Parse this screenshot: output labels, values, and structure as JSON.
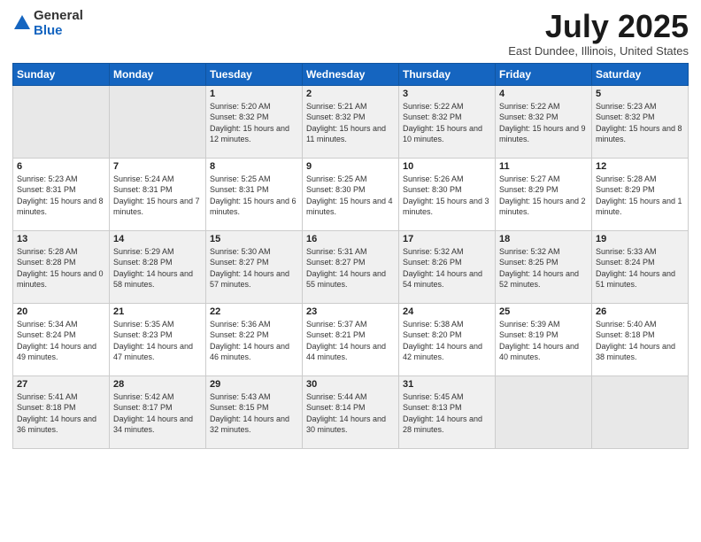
{
  "logo": {
    "general": "General",
    "blue": "Blue"
  },
  "title": {
    "month_year": "July 2025",
    "location": "East Dundee, Illinois, United States"
  },
  "weekdays": [
    "Sunday",
    "Monday",
    "Tuesday",
    "Wednesday",
    "Thursday",
    "Friday",
    "Saturday"
  ],
  "weeks": [
    [
      {
        "day": "",
        "sunrise": "",
        "sunset": "",
        "daylight": ""
      },
      {
        "day": "",
        "sunrise": "",
        "sunset": "",
        "daylight": ""
      },
      {
        "day": "1",
        "sunrise": "Sunrise: 5:20 AM",
        "sunset": "Sunset: 8:32 PM",
        "daylight": "Daylight: 15 hours and 12 minutes."
      },
      {
        "day": "2",
        "sunrise": "Sunrise: 5:21 AM",
        "sunset": "Sunset: 8:32 PM",
        "daylight": "Daylight: 15 hours and 11 minutes."
      },
      {
        "day": "3",
        "sunrise": "Sunrise: 5:22 AM",
        "sunset": "Sunset: 8:32 PM",
        "daylight": "Daylight: 15 hours and 10 minutes."
      },
      {
        "day": "4",
        "sunrise": "Sunrise: 5:22 AM",
        "sunset": "Sunset: 8:32 PM",
        "daylight": "Daylight: 15 hours and 9 minutes."
      },
      {
        "day": "5",
        "sunrise": "Sunrise: 5:23 AM",
        "sunset": "Sunset: 8:32 PM",
        "daylight": "Daylight: 15 hours and 8 minutes."
      }
    ],
    [
      {
        "day": "6",
        "sunrise": "Sunrise: 5:23 AM",
        "sunset": "Sunset: 8:31 PM",
        "daylight": "Daylight: 15 hours and 8 minutes."
      },
      {
        "day": "7",
        "sunrise": "Sunrise: 5:24 AM",
        "sunset": "Sunset: 8:31 PM",
        "daylight": "Daylight: 15 hours and 7 minutes."
      },
      {
        "day": "8",
        "sunrise": "Sunrise: 5:25 AM",
        "sunset": "Sunset: 8:31 PM",
        "daylight": "Daylight: 15 hours and 6 minutes."
      },
      {
        "day": "9",
        "sunrise": "Sunrise: 5:25 AM",
        "sunset": "Sunset: 8:30 PM",
        "daylight": "Daylight: 15 hours and 4 minutes."
      },
      {
        "day": "10",
        "sunrise": "Sunrise: 5:26 AM",
        "sunset": "Sunset: 8:30 PM",
        "daylight": "Daylight: 15 hours and 3 minutes."
      },
      {
        "day": "11",
        "sunrise": "Sunrise: 5:27 AM",
        "sunset": "Sunset: 8:29 PM",
        "daylight": "Daylight: 15 hours and 2 minutes."
      },
      {
        "day": "12",
        "sunrise": "Sunrise: 5:28 AM",
        "sunset": "Sunset: 8:29 PM",
        "daylight": "Daylight: 15 hours and 1 minute."
      }
    ],
    [
      {
        "day": "13",
        "sunrise": "Sunrise: 5:28 AM",
        "sunset": "Sunset: 8:28 PM",
        "daylight": "Daylight: 15 hours and 0 minutes."
      },
      {
        "day": "14",
        "sunrise": "Sunrise: 5:29 AM",
        "sunset": "Sunset: 8:28 PM",
        "daylight": "Daylight: 14 hours and 58 minutes."
      },
      {
        "day": "15",
        "sunrise": "Sunrise: 5:30 AM",
        "sunset": "Sunset: 8:27 PM",
        "daylight": "Daylight: 14 hours and 57 minutes."
      },
      {
        "day": "16",
        "sunrise": "Sunrise: 5:31 AM",
        "sunset": "Sunset: 8:27 PM",
        "daylight": "Daylight: 14 hours and 55 minutes."
      },
      {
        "day": "17",
        "sunrise": "Sunrise: 5:32 AM",
        "sunset": "Sunset: 8:26 PM",
        "daylight": "Daylight: 14 hours and 54 minutes."
      },
      {
        "day": "18",
        "sunrise": "Sunrise: 5:32 AM",
        "sunset": "Sunset: 8:25 PM",
        "daylight": "Daylight: 14 hours and 52 minutes."
      },
      {
        "day": "19",
        "sunrise": "Sunrise: 5:33 AM",
        "sunset": "Sunset: 8:24 PM",
        "daylight": "Daylight: 14 hours and 51 minutes."
      }
    ],
    [
      {
        "day": "20",
        "sunrise": "Sunrise: 5:34 AM",
        "sunset": "Sunset: 8:24 PM",
        "daylight": "Daylight: 14 hours and 49 minutes."
      },
      {
        "day": "21",
        "sunrise": "Sunrise: 5:35 AM",
        "sunset": "Sunset: 8:23 PM",
        "daylight": "Daylight: 14 hours and 47 minutes."
      },
      {
        "day": "22",
        "sunrise": "Sunrise: 5:36 AM",
        "sunset": "Sunset: 8:22 PM",
        "daylight": "Daylight: 14 hours and 46 minutes."
      },
      {
        "day": "23",
        "sunrise": "Sunrise: 5:37 AM",
        "sunset": "Sunset: 8:21 PM",
        "daylight": "Daylight: 14 hours and 44 minutes."
      },
      {
        "day": "24",
        "sunrise": "Sunrise: 5:38 AM",
        "sunset": "Sunset: 8:20 PM",
        "daylight": "Daylight: 14 hours and 42 minutes."
      },
      {
        "day": "25",
        "sunrise": "Sunrise: 5:39 AM",
        "sunset": "Sunset: 8:19 PM",
        "daylight": "Daylight: 14 hours and 40 minutes."
      },
      {
        "day": "26",
        "sunrise": "Sunrise: 5:40 AM",
        "sunset": "Sunset: 8:18 PM",
        "daylight": "Daylight: 14 hours and 38 minutes."
      }
    ],
    [
      {
        "day": "27",
        "sunrise": "Sunrise: 5:41 AM",
        "sunset": "Sunset: 8:18 PM",
        "daylight": "Daylight: 14 hours and 36 minutes."
      },
      {
        "day": "28",
        "sunrise": "Sunrise: 5:42 AM",
        "sunset": "Sunset: 8:17 PM",
        "daylight": "Daylight: 14 hours and 34 minutes."
      },
      {
        "day": "29",
        "sunrise": "Sunrise: 5:43 AM",
        "sunset": "Sunset: 8:15 PM",
        "daylight": "Daylight: 14 hours and 32 minutes."
      },
      {
        "day": "30",
        "sunrise": "Sunrise: 5:44 AM",
        "sunset": "Sunset: 8:14 PM",
        "daylight": "Daylight: 14 hours and 30 minutes."
      },
      {
        "day": "31",
        "sunrise": "Sunrise: 5:45 AM",
        "sunset": "Sunset: 8:13 PM",
        "daylight": "Daylight: 14 hours and 28 minutes."
      },
      {
        "day": "",
        "sunrise": "",
        "sunset": "",
        "daylight": ""
      },
      {
        "day": "",
        "sunrise": "",
        "sunset": "",
        "daylight": ""
      }
    ]
  ]
}
